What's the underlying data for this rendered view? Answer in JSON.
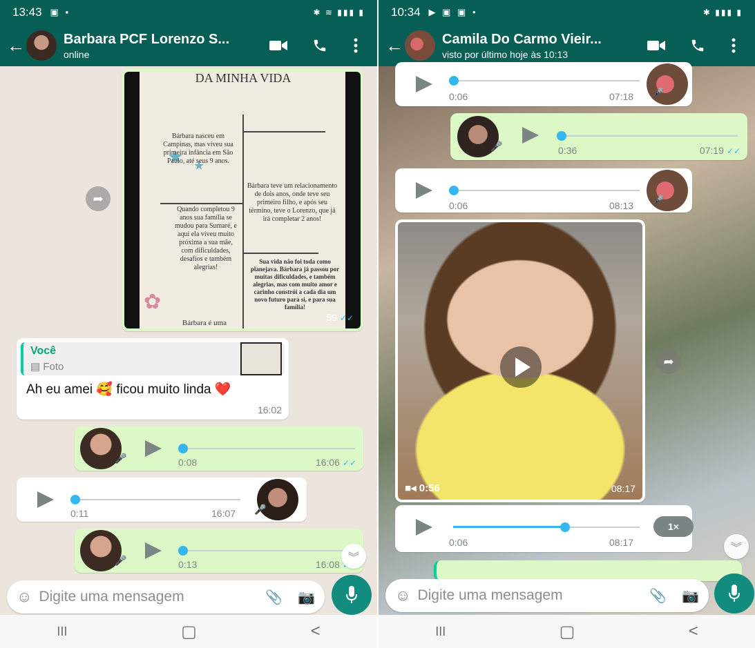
{
  "left": {
    "status": {
      "time": "13:43"
    },
    "header": {
      "name": "Barbara PCF Lorenzo S...",
      "subtitle": "online"
    },
    "image_doc": {
      "title": "DA MINHA VIDA",
      "p1": "Bárbara nasceu em Campinas, mas viveu sua primeira infância em São Paulo, até seus 9 anos.",
      "p2": "Bárbara teve um relacionamento de dois anos, onde teve seu primeiro filho, e após seu término, teve o Lorenzo, que já irá completar 2 anos!",
      "p3": "Quando completou 9 anos sua família se mudou para Sumaré, e aqui ela viveu muito próxima a sua mãe, com dificuldades, desafios e também alegrias!",
      "p4": "Sua vida não foi toda como planejava. Bárbara já passou por muitas dificuldades, e também alegrias, mas com muito amor e carinho constrói a cada dia um novo futuro para si, e para sua família!",
      "p5": "Bárbara é uma",
      "time": "59"
    },
    "reply": {
      "quote_author": "Você",
      "quote_type": "Foto",
      "text": "Ah eu amei 🥰 ficou muito linda ❤️",
      "time": "16:02"
    },
    "audio1": {
      "duration": "0:08",
      "time": "16:06",
      "progress": 0.0
    },
    "audio2": {
      "duration": "0:11",
      "time": "16:07",
      "progress": 0.0
    },
    "audio3": {
      "duration": "0:13",
      "time": "16:08",
      "progress": 0.0
    },
    "composer": {
      "placeholder": "Digite uma mensagem"
    },
    "nav": {
      "recent": "III",
      "home": "▢",
      "back": "<"
    }
  },
  "right": {
    "status": {
      "time": "10:34"
    },
    "header": {
      "name": "Camila Do Carmo Vieir...",
      "subtitle": "visto por último hoje às 10:13"
    },
    "audio1": {
      "duration": "0:06",
      "time": "07:18",
      "progress": 0.0
    },
    "audio2": {
      "duration": "0:36",
      "time": "07:19",
      "progress": 0.0
    },
    "audio3": {
      "duration": "0:06",
      "time": "08:13",
      "progress": 0.0
    },
    "video": {
      "duration": "0:56",
      "time": "08:17"
    },
    "audio4": {
      "duration": "0:06",
      "time": "08:17",
      "progress": 0.6,
      "speed": "1×"
    },
    "composer": {
      "placeholder": "Digite uma mensagem"
    },
    "nav": {
      "recent": "III",
      "home": "▢",
      "back": "<"
    }
  },
  "colors": {
    "header": "#075e54",
    "outgoing": "#dcf8c6",
    "incoming": "#ffffff",
    "accent": "#34b7f1",
    "fab": "#128c7e"
  }
}
